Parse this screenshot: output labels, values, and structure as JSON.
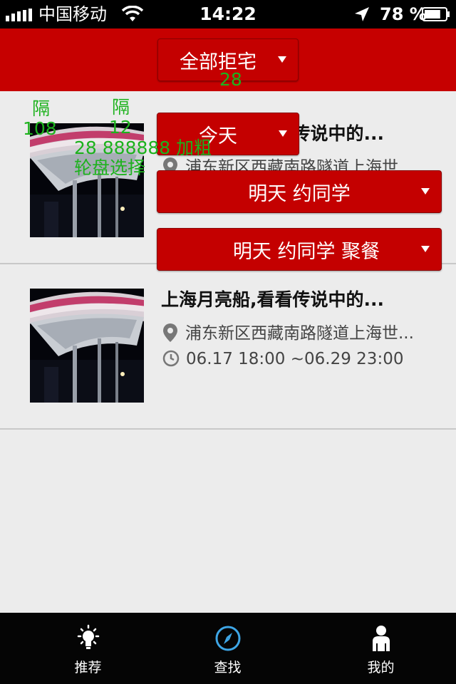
{
  "status_bar": {
    "carrier": "中国移动",
    "time": "14:22",
    "battery": "78 %",
    "battery_level": 0.78
  },
  "filters": {
    "all_homes": "全部拒宅",
    "today": "今天",
    "tomorrow_friends": "明天 约同学",
    "tomorrow_friends_party": "明天 约同学 聚餐"
  },
  "events": [
    {
      "title": "上海月亮船,看看传说中的...",
      "address": "浦东新区西藏南路隧道上海世...",
      "time": ""
    },
    {
      "title": "上海月亮船,看看传说中的...",
      "address": "浦东新区西藏南路隧道上海世...",
      "time": "06.17 18:00 ~06.29 23:00"
    }
  ],
  "debug_overlay": {
    "label_28": "28",
    "gap_1": "隔",
    "gap_1_value": "108",
    "gap_2": "隔",
    "gap_2_value": "12",
    "font_note": "28 888888 加粗",
    "wheel_note": "轮盘选择"
  },
  "tabs": [
    {
      "label": "推荐",
      "icon": "lightbulb-icon"
    },
    {
      "label": "查找",
      "icon": "compass-icon"
    },
    {
      "label": "我的",
      "icon": "person-icon"
    }
  ],
  "colors": {
    "header_red": "#c60000",
    "debug_green": "#1db21d",
    "tab_bar": "#050505",
    "compass_active": "#3ea6e6"
  }
}
